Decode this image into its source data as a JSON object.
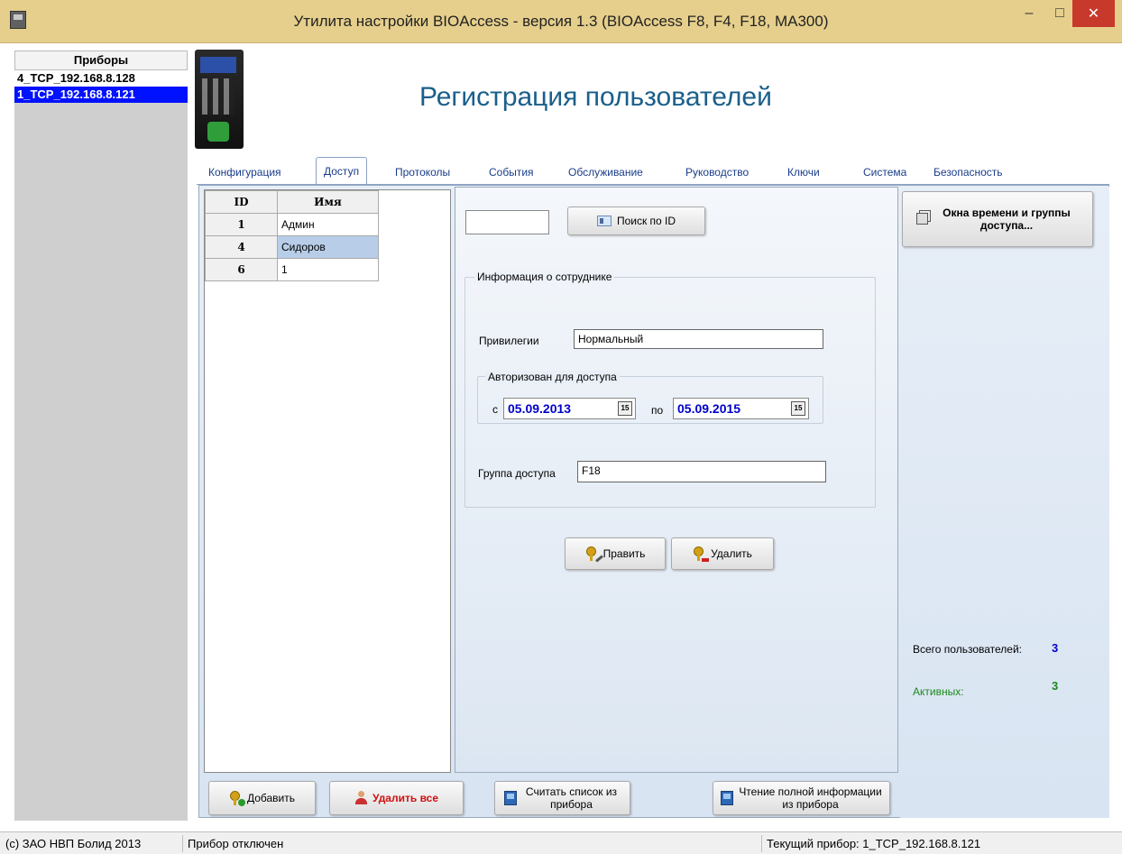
{
  "window": {
    "title": "Утилита настройки BIOAccess - версия 1.3 (BIOAccess F8, F4, F18, MA300)",
    "min_glyph": "–",
    "max_glyph": "□",
    "close_glyph": "✕"
  },
  "devices": {
    "header": "Приборы",
    "items": [
      {
        "label": "4_TCP_192.168.8.128",
        "selected": false
      },
      {
        "label": "1_TCP_192.168.8.121",
        "selected": true
      }
    ]
  },
  "page_heading": "Регистрация пользователей",
  "tabs": [
    "Конфигурация",
    "Доступ",
    "Протоколы",
    "События",
    "Обслуживание",
    "Руководство",
    "Ключи",
    "Система",
    "Безопасность"
  ],
  "active_tab": "Доступ",
  "users_table": {
    "columns": [
      "ID",
      "Имя"
    ],
    "rows": [
      {
        "id": "1",
        "name": "Админ",
        "selected": false
      },
      {
        "id": "4",
        "name": "Сидоров",
        "selected": true
      },
      {
        "id": "6",
        "name": "1",
        "selected": false
      }
    ]
  },
  "search": {
    "id_value": "",
    "button_label": "Поиск по ID"
  },
  "employee": {
    "group_title": "Информация о сотруднике",
    "privileges_label": "Привилегии",
    "privileges_value": "Нормальный",
    "auth_group_title": "Авторизован для доступа",
    "from_label": "с",
    "from_date": "05.09.2013",
    "to_label": "по",
    "to_date": "05.09.2015",
    "calendar_glyph": "15",
    "access_group_label": "Группа доступа",
    "access_group_value": "F18"
  },
  "actions": {
    "edit_label": "Править",
    "delete_label": "Удалить"
  },
  "right_panel": {
    "time_windows_button": "Окна времени и группы доступа...",
    "total_users_label": "Всего пользователей:",
    "total_users_value": "3",
    "active_label": "Активных:",
    "active_value": "3"
  },
  "bottom_buttons": {
    "add_label": "Добавить",
    "delete_all_label": "Удалить все",
    "read_list_label": "Считать список из прибора",
    "read_full_label": "Чтение полной информации из прибора"
  },
  "status_bar": {
    "copyright": "(c) ЗАО НВП Болид 2013",
    "device_state": "Прибор отключен",
    "current_device": "Текущий прибор: 1_TCP_192.168.8.121"
  },
  "colors": {
    "titlebar": "#e6cf8c",
    "selection_blue": "#0011ff",
    "heading": "#1a5f8a",
    "total_value": "#0000cc",
    "active_value": "#1a8a1a",
    "delete_all_text": "#d01010"
  }
}
